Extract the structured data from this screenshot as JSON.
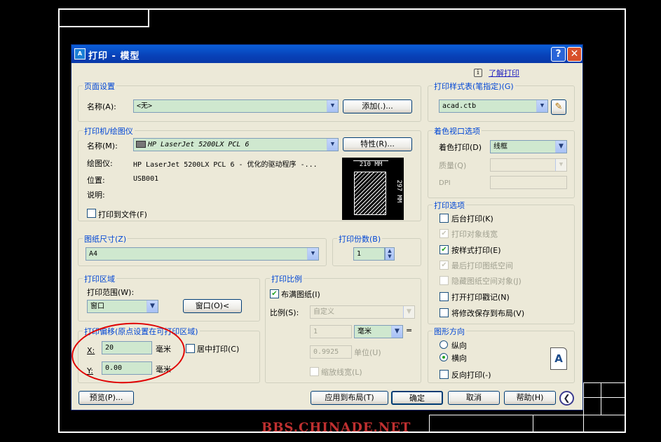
{
  "dialog": {
    "title": "打印 - 模型",
    "help": "?",
    "close": "✕"
  },
  "learn_link": "了解打印",
  "page_setup": {
    "group": "页面设置",
    "name_label": "名称(A):",
    "name_value": "<无>",
    "add_button": "添加(.)..."
  },
  "plotter": {
    "group": "打印机/绘图仪",
    "name_label": "名称(M):",
    "name_value": "HP LaserJet 5200LX PCL 6",
    "props_button": "特性(R)...",
    "plotter_label": "绘图仪:",
    "plotter_value": "HP LaserJet 5200LX PCL 6 - 优化的驱动程序 -...",
    "location_label": "位置:",
    "location_value": "USB001",
    "desc_label": "说明:",
    "print_to_file": "打印到文件(F)",
    "preview_width": "210 MM",
    "preview_height": "297 MM"
  },
  "paper_size": {
    "group": "图纸尺寸(Z)",
    "value": "A4"
  },
  "copies": {
    "group": "打印份数(B)",
    "value": "1"
  },
  "plot_area": {
    "group": "打印区域",
    "range_label": "打印范围(W):",
    "range_value": "窗口",
    "window_button": "窗口(O)<"
  },
  "plot_offset": {
    "group": "打印偏移(原点设置在可打印区域)",
    "x_label": "X:",
    "x_value": "20",
    "x_unit": "毫米",
    "y_label": "Y:",
    "y_value": "0.00",
    "y_unit": "毫米",
    "center": "居中打印(C)"
  },
  "plot_scale": {
    "group": "打印比例",
    "fit": "布满图纸(I)",
    "scale_label": "比例(S):",
    "scale_value": "自定义",
    "v1": "1",
    "unit1": "毫米",
    "v2": "0.9925",
    "unit2": "单位(U)",
    "lineweights": "缩放线宽(L)",
    "eq": "="
  },
  "plot_style": {
    "group": "打印样式表(笔指定)(G)",
    "value": "acad.ctb"
  },
  "shaded": {
    "group": "着色视口选项",
    "shade_label": "着色打印(D)",
    "shade_value": "线框",
    "quality_label": "质量(Q)",
    "dpi_label": "DPI"
  },
  "options": {
    "group": "打印选项",
    "items": [
      "后台打印(K)",
      "打印对象线宽",
      "按样式打印(E)",
      "最后打印图纸空间",
      "隐藏图纸空间对象(J)",
      "打开打印戳记(N)",
      "将修改保存到布局(V)"
    ]
  },
  "orientation": {
    "group": "图形方向",
    "portrait": "纵向",
    "landscape": "横向",
    "reverse": "反向打印(-)",
    "icon_letter": "A"
  },
  "footer": {
    "preview": "预览(P)...",
    "apply": "应用到布局(T)",
    "ok": "确定",
    "cancel": "取消",
    "help": "帮助(H)"
  },
  "watermark": "BBS.CHINADE.NET",
  "colors": {
    "title_bar": "#0a5fd8",
    "dialog_bg": "#ece9d8",
    "group_title": "#0046d5",
    "field": "#cfe8cf",
    "annotation": "#e00000"
  }
}
